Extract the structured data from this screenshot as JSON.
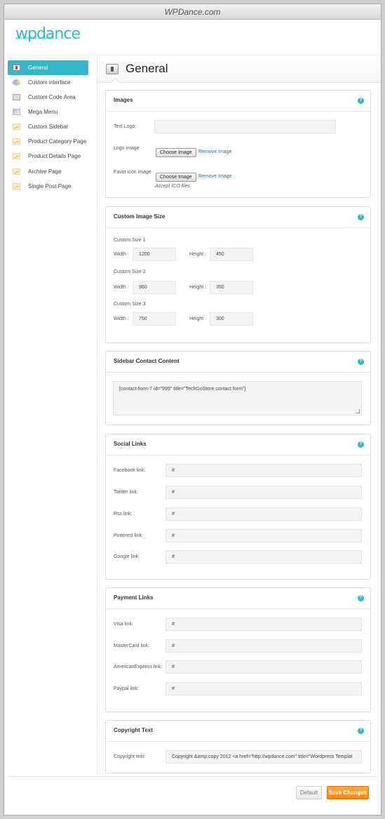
{
  "window": {
    "title": "WPDance.com"
  },
  "logo": {
    "main": "wpdance",
    "sub": "wordpress c-panel"
  },
  "sidebar": {
    "items": [
      {
        "label": "General",
        "icon": "general-icon",
        "active": true
      },
      {
        "label": "Custom interface",
        "icon": "palette-icon",
        "active": false
      },
      {
        "label": "Custom Code Area",
        "icon": "code-icon",
        "active": false
      },
      {
        "label": "Mega Menu",
        "icon": "mega-menu-icon",
        "active": false
      },
      {
        "label": "Custom Sidebar",
        "icon": "chart-icon",
        "active": false
      },
      {
        "label": "Product Category Page",
        "icon": "chart-icon",
        "active": false
      },
      {
        "label": "Product Details Page",
        "icon": "chart-icon",
        "active": false
      },
      {
        "label": "Archive Page",
        "icon": "chart-icon",
        "active": false
      },
      {
        "label": "Single Post Page",
        "icon": "chart-icon",
        "active": false
      }
    ]
  },
  "page": {
    "title": "General"
  },
  "images": {
    "title": "Images",
    "help": "?",
    "text_logo_label": "Text Logo:",
    "text_logo_value": "",
    "logo_image_label": "Logo image",
    "favicon_label": "Favor icon image",
    "choose_label": "Choose Image",
    "remove_label": "Remove Image",
    "favicon_note": "Accept ICO files"
  },
  "image_size": {
    "title": "Custom Image Size",
    "help": "?",
    "width_label": "Width :",
    "height_label": "Height :",
    "sizes": [
      {
        "label": "Custom Size 1",
        "width": "1200",
        "height": "450"
      },
      {
        "label": "Custom Size 2",
        "width": "960",
        "height": "350"
      },
      {
        "label": "Custom Size 3",
        "width": "750",
        "height": "300"
      }
    ]
  },
  "sidebar_contact": {
    "title": "Sidebar Contact Content",
    "help": "?",
    "content": "[contact-form-7 id=\"999\" title=\"TechGoStore contact form\"]"
  },
  "social": {
    "title": "Social Links",
    "help": "?",
    "links": [
      {
        "label": "Facebook link:",
        "value": "#"
      },
      {
        "label": "Twitter link:",
        "value": "#"
      },
      {
        "label": "Rss link:",
        "value": "#"
      },
      {
        "label": "Pinterest link:",
        "value": "#"
      },
      {
        "label": "Google link:",
        "value": "#"
      }
    ]
  },
  "payment": {
    "title": "Payment Links",
    "help": "?",
    "links": [
      {
        "label": "Visa link:",
        "value": "#"
      },
      {
        "label": "MasterCard link:",
        "value": "#"
      },
      {
        "label": "AmericanExpress link:",
        "value": "#"
      },
      {
        "label": "Paypal link:",
        "value": "#"
      }
    ]
  },
  "copyright": {
    "title": "Copyright Text",
    "help": "?",
    "label": "Copyright text:",
    "value": "Copyright &amp;copy 2012 <a href=\"http://wpdance.com\" title=\"Wordpress Templat"
  },
  "footer": {
    "default_label": "Default",
    "save_label": "Save Changes"
  }
}
